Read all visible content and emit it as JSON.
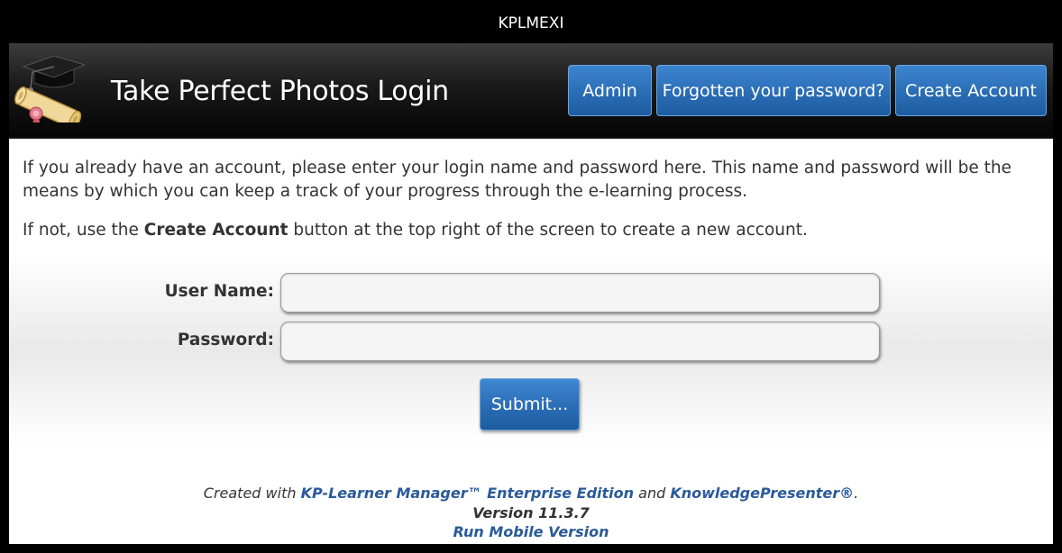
{
  "window": {
    "title": "KPLMEXI"
  },
  "header": {
    "title": "Take Perfect Photos Login",
    "logo_icon": "graduation-cap-diploma-icon",
    "buttons": {
      "admin": "Admin",
      "forgot": "Forgotten your password?",
      "create": "Create Account"
    }
  },
  "intro": {
    "line1": "If you already have an account, please enter your login name and password here. This name and password will be the means by which you can keep a track of your progress through the e-learning process.",
    "line2_before": "If not, use the ",
    "line2_bold": "Create Account",
    "line2_after": " button at the top right of the screen to create a new account."
  },
  "form": {
    "username_label": "User Name:",
    "username_value": "",
    "password_label": "Password:",
    "password_value": "",
    "submit_label": "Submit..."
  },
  "footer": {
    "created_with": "Created with ",
    "product": "KP-Learner Manager™ Enterprise Edition",
    "and": " and ",
    "presenter": "KnowledgePresenter®",
    "period": ".",
    "version": "Version 11.3.7",
    "mobile_link": "Run Mobile Version"
  },
  "colors": {
    "button_blue": "#2a6db5",
    "link_blue": "#2a5a9b",
    "header_black": "#050505"
  }
}
